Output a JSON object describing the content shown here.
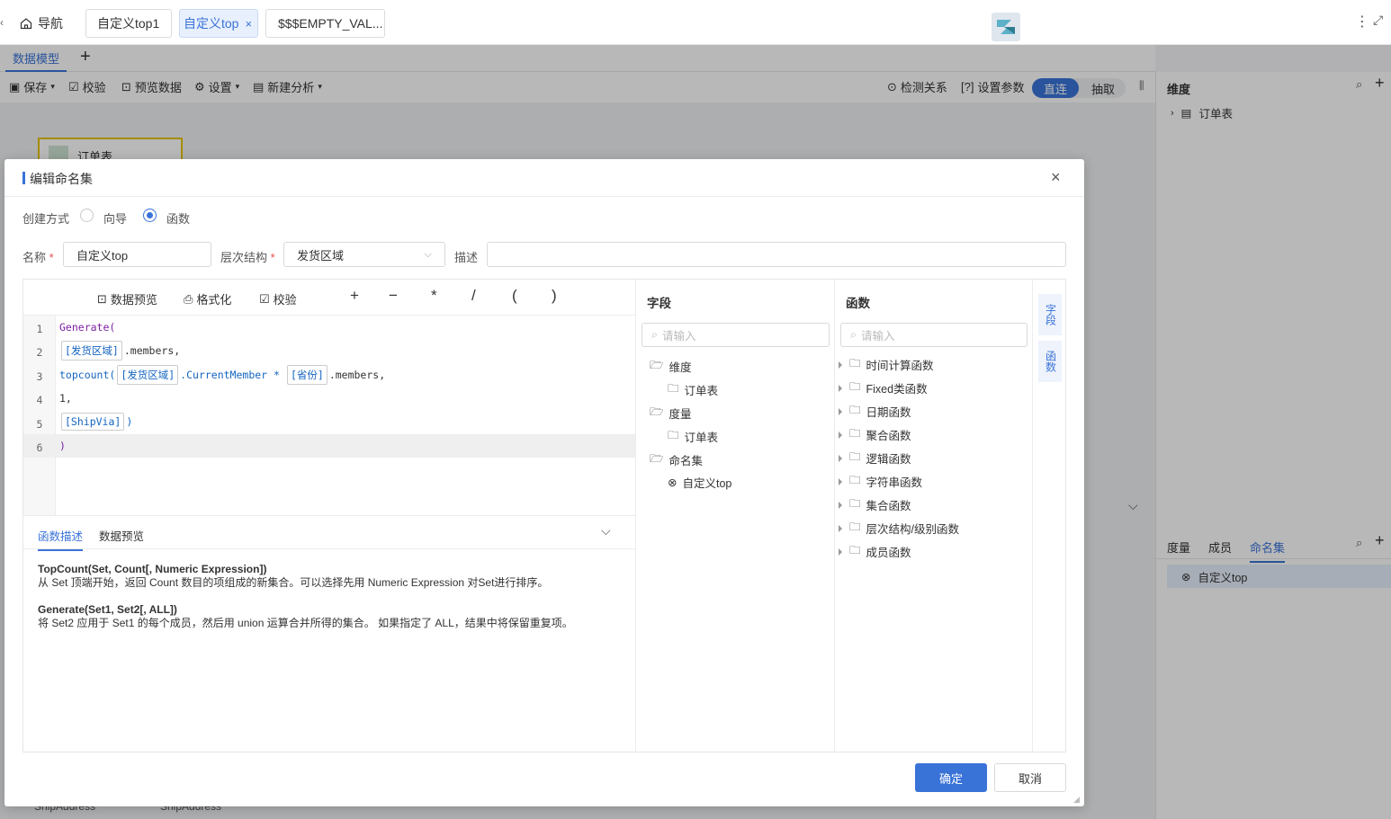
{
  "topbar": {
    "back_icon": "chevron-left-icon",
    "nav_label": "导航",
    "tabs": [
      {
        "label": "自定义top1",
        "active": false
      },
      {
        "label": "自定义top",
        "active": true
      },
      {
        "label": "$$$EMPTY_VAL..."
      }
    ],
    "logo_icon": "app-logo"
  },
  "model": {
    "tab_label": "数据模型",
    "add_icon": "plus-icon",
    "toolbar": {
      "save": "保存",
      "check": "校验",
      "preview": "预览数据",
      "settings": "设置",
      "new_analysis": "新建分析",
      "detect": "检测关系",
      "set_params": "设置参数",
      "direct": "直连",
      "extract": "抽取"
    },
    "table_node": "订单表",
    "bottom_row": [
      "ShipAddress",
      "ShipAddress"
    ]
  },
  "right_panel": {
    "dim_title": "维度",
    "dim_item": "订单表",
    "tabs": [
      "度量",
      "成员",
      "命名集"
    ],
    "active_tab": "命名集",
    "named_item": "自定义top"
  },
  "dialog": {
    "title": "编辑命名集",
    "create_mode_label": "创建方式",
    "mode_wizard": "向导",
    "mode_function": "函数",
    "selected_mode": "函数",
    "name_label": "名称",
    "name_value": "自定义top",
    "hierarchy_label": "层次结构",
    "hierarchy_value": "发货区域",
    "desc_label": "描述",
    "desc_value": "",
    "editor_tools": {
      "preview": "数据预览",
      "format": "格式化",
      "check": "校验",
      "ops": [
        "+",
        "−",
        "*",
        "/",
        "(",
        ")"
      ]
    },
    "code": {
      "line_numbers": [
        "1",
        "2",
        "3",
        "4",
        "5",
        "6"
      ],
      "l1": "Generate(",
      "l2_tok": "[发货区域]",
      "l2_rest": ".members,",
      "l3_fn": "topcount(",
      "l3_tok1": "[发货区域]",
      "l3_mid": ".CurrentMember *",
      "l3_tok2": "[省份]",
      "l3_rest": ".members,",
      "l4": "1,",
      "l5_tok": "[ShipVia]",
      "l5_rest": ")",
      "l6": ")"
    },
    "desc_tabs": [
      "函数描述",
      "数据预览"
    ],
    "desc_active": "函数描述",
    "func_desc": {
      "topcount_sig": "TopCount(Set, Count[, Numeric Expression])",
      "topcount_text": "从 Set 顶端开始，返回 Count 数目的项组成的新集合。可以选择先用 Numeric Expression 对Set进行排序。",
      "generate_sig": "Generate(Set1, Set2[, ALL])",
      "generate_text": "将 Set2 应用于 Set1 的每个成员，然后用 union 运算合并所得的集合。 如果指定了 ALL，结果中将保留重复项。"
    },
    "fields": {
      "title": "字段",
      "search_placeholder": "请输入",
      "dim_folder": "维度",
      "dim_table": "订单表",
      "measure_folder": "度量",
      "measure_table": "订单表",
      "namedset_folder": "命名集",
      "namedset_item": "自定义top"
    },
    "functions": {
      "title": "函数",
      "search_placeholder": "请输入",
      "items": [
        "时间计算函数",
        "Fixed类函数",
        "日期函数",
        "聚合函数",
        "逻辑函数",
        "字符串函数",
        "集合函数",
        "层次结构/级别函数",
        "成员函数"
      ]
    },
    "side_tabs": [
      "字段",
      "函数"
    ],
    "ok": "确定",
    "cancel": "取消",
    "colors": {
      "primary": "#3a73d8",
      "required": "#e34d4d"
    }
  }
}
